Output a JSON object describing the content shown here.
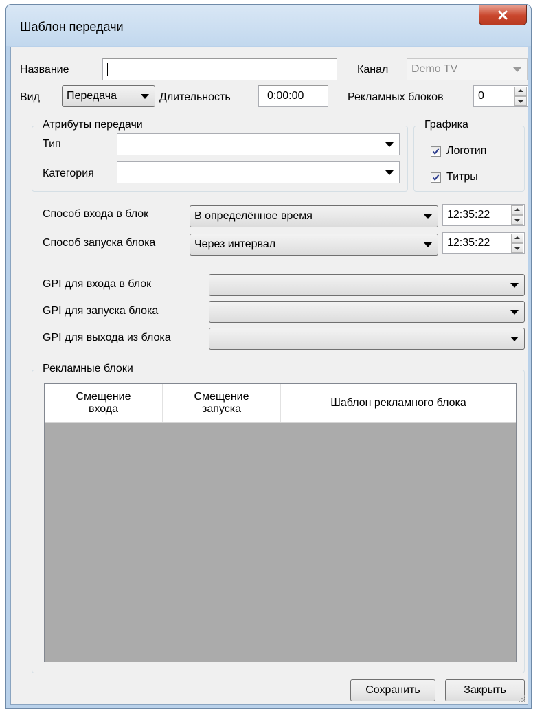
{
  "window": {
    "title": "Шаблон передачи"
  },
  "fields": {
    "name_label": "Название",
    "name_value": "",
    "channel_label": "Канал",
    "channel_value": "Demo TV",
    "kind_label": "Вид",
    "kind_value": "Передача",
    "duration_label": "Длительность",
    "duration_value": "0:00:00",
    "ad_blocks_label": "Рекламных блоков",
    "ad_blocks_value": "0"
  },
  "attributes": {
    "group_title": "Атрибуты передачи",
    "type_label": "Тип",
    "type_value": "",
    "category_label": "Категория",
    "category_value": ""
  },
  "graphics": {
    "group_title": "Графика",
    "logo_label": "Логотип",
    "logo_checked": true,
    "titles_label": "Титры",
    "titles_checked": true
  },
  "block_entry": {
    "label": "Способ входа в блок",
    "value": "В определённое время",
    "time": "12:35:22"
  },
  "block_start": {
    "label": "Способ запуска блока",
    "value": "Через интервал",
    "time": "12:35:22"
  },
  "gpi": {
    "entry_label": "GPI для входа в блок",
    "entry_value": "",
    "start_label": "GPI для запуска блока",
    "start_value": "",
    "exit_label": "GPI для выхода из блока",
    "exit_value": ""
  },
  "ad_blocks": {
    "group_title": "Рекламные блоки",
    "columns": [
      "Смещение\nвхода",
      "Смещение\nзапуска",
      "Шаблон рекламного блока"
    ],
    "rows": []
  },
  "buttons": {
    "save": "Сохранить",
    "close": "Закрыть"
  },
  "colors": {
    "grid_empty": "#ababab",
    "close_button": "#c9462c"
  }
}
